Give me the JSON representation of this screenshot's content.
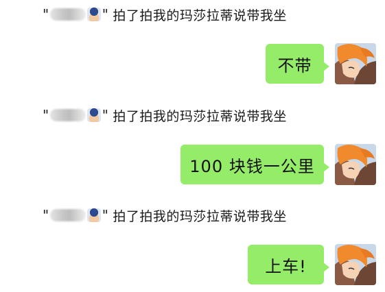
{
  "chat": {
    "system_notices": [
      {
        "text": "拍了拍我的玛莎拉蒂说带我坐"
      },
      {
        "text": "拍了拍我的玛莎拉蒂说带我坐"
      },
      {
        "text": "拍了拍我的玛莎拉蒂说带我坐"
      }
    ],
    "messages": [
      {
        "text": "不带"
      },
      {
        "text": "100 块钱一公里"
      },
      {
        "text": "上车!"
      }
    ]
  },
  "colors": {
    "bubble": "#95ec69",
    "background": "#ffffff"
  },
  "icons": {
    "self_avatar": "anime-character-avatar",
    "sender_avatar": "blurred-user-avatar"
  }
}
